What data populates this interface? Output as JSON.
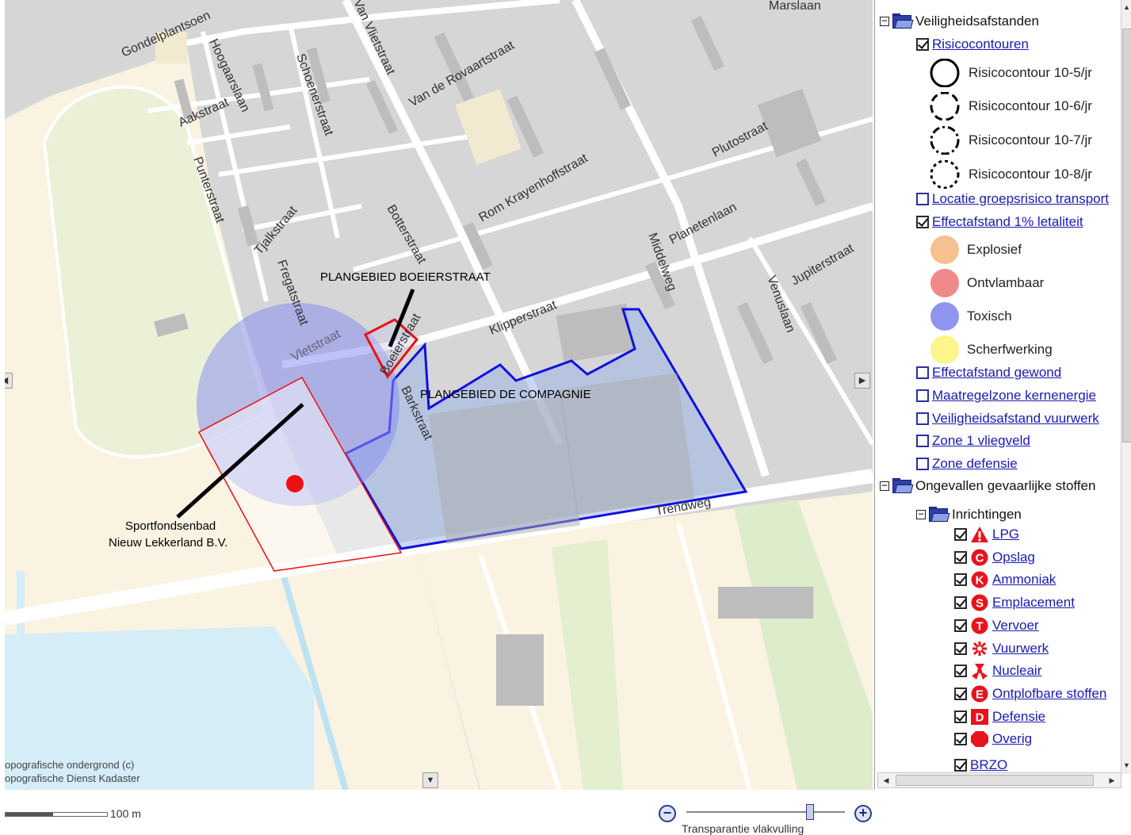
{
  "map": {
    "streets": [
      "Marslaan",
      "Gondelplantsoen",
      "Hoogaarslaan",
      "Aakstraat",
      "Schoenerstraat",
      "Van Vlietstraat",
      "Van de Rovaartstraat",
      "Punterstraat",
      "Tjalkstraat",
      "Fregatstraat",
      "Botterstraat",
      "Rom Krayenhoffstraat",
      "Plutostraat",
      "Planetenlaan",
      "Middelweg",
      "Jupiterstraat",
      "Venuslaan",
      "Klipperstraat",
      "Vletstraat",
      "Boeierstraat",
      "Barkstraat",
      "Trendweg"
    ],
    "labels": {
      "plangebied_boeierstraat": "PLANGEBIED BOEIERSTRAAT",
      "plangebied_compagnie": "PLANGEBIED DE COMPAGNIE",
      "sportfondsenbad_1": "Sportfondsenbad",
      "sportfondsenbad_2": "Nieuw Lekkerland B.V."
    },
    "credit_1": "opografische ondergrond (c)",
    "credit_2": "opografische Dienst Kadaster",
    "arrow_right": "▶",
    "arrow_down": "▼",
    "arrow_left": "◀"
  },
  "legend": {
    "group1": {
      "title": "Veiligheidsafstanden",
      "expander": "−"
    },
    "risicocontouren": "Risicocontouren",
    "contours": [
      "Risicocontour 10-5/jr",
      "Risicocontour 10-6/jr",
      "Risicocontour 10-7/jr",
      "Risicocontour 10-8/jr"
    ],
    "locatie": "Locatie groepsrisico transport",
    "effectafstand": "Effectafstand 1% letaliteit",
    "effects": [
      "Explosief",
      "Ontvlambaar",
      "Toxisch",
      "Scherfwerking"
    ],
    "effect_colors": [
      "#f5c28f",
      "#f08a8a",
      "#8f94ee",
      "#fbf58a"
    ],
    "layers_unchecked": [
      "Effectafstand gewond",
      "Maatregelzone kernenergie",
      "Veiligheidsafstand vuurwerk",
      "Zone 1 vliegveld",
      "Zone defensie"
    ],
    "group2": {
      "title": "Ongevallen gevaarlijke stoffen",
      "expander": "−"
    },
    "inrichtingen": {
      "title": "Inrichtingen",
      "expander": "−"
    },
    "items": [
      {
        "label": "LPG",
        "icon": "triangle-warning-icon"
      },
      {
        "label": "Opslag",
        "icon": "circle-c-icon",
        "letter": "C"
      },
      {
        "label": "Ammoniak",
        "icon": "circle-k-icon",
        "letter": "K"
      },
      {
        "label": "Emplacement",
        "icon": "circle-s-icon",
        "letter": "S"
      },
      {
        "label": "Vervoer",
        "icon": "circle-t-icon",
        "letter": "T"
      },
      {
        "label": "Vuurwerk",
        "icon": "firework-icon"
      },
      {
        "label": "Nucleair",
        "icon": "nuclear-icon"
      },
      {
        "label": "Ontplofbare stoffen",
        "icon": "circle-e-icon",
        "letter": "E"
      },
      {
        "label": "Defensie",
        "icon": "square-d-icon",
        "letter": "D"
      },
      {
        "label": "Overig",
        "icon": "octagon-icon"
      }
    ],
    "brzo": "BRZO",
    "icon_color": "#e8131b"
  },
  "footer": {
    "scale_label": "100 m",
    "transparency_label": "Transparantie vlakvulling",
    "zoom_out": "−",
    "zoom_in": "+",
    "transparency_value": 0.78
  }
}
